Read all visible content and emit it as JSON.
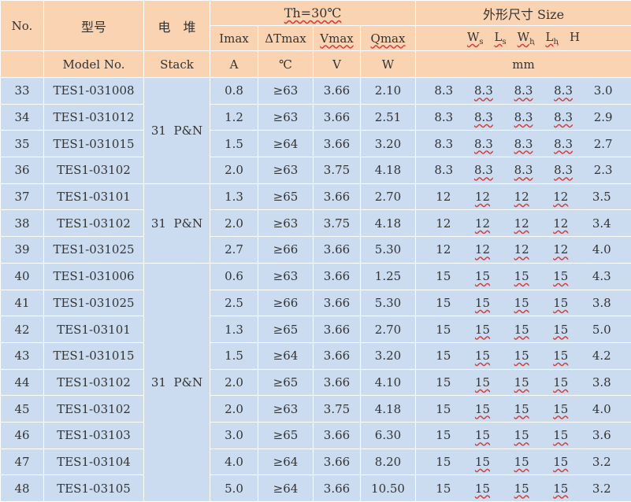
{
  "headers": {
    "no": "No.",
    "model_cn": "型号",
    "stack_cn": "电　堆",
    "th": "Th=30℃",
    "size": "外形尺寸 Size",
    "imax": "Imax",
    "dtmax": "ΔTmax",
    "vmax": "Vmax",
    "qmax": "Qmax",
    "w": "W",
    "w_sub": "s",
    "l": "L",
    "l_sub": "s",
    "wh": "W",
    "wh_sub": "h",
    "lh": "L",
    "lh_sub": "h",
    "h": "H",
    "model_en": "Model No.",
    "stack_en": "Stack",
    "unit_a": "A",
    "unit_c": "℃",
    "unit_v": "V",
    "unit_w": "W",
    "unit_mm": "mm"
  },
  "stack_groups": [
    "31  P&N",
    "31  P&N",
    "31  P&N"
  ],
  "rows": [
    {
      "no": "33",
      "model": "TES1-031008",
      "imax": "0.8",
      "dt": "≥63",
      "v": "3.66",
      "q": "2.10",
      "s": [
        "8.3",
        "8.3",
        "8.3",
        "8.3",
        "3.0"
      ]
    },
    {
      "no": "34",
      "model": "TES1-031012",
      "imax": "1.2",
      "dt": "≥63",
      "v": "3.66",
      "q": "2.51",
      "s": [
        "8.3",
        "8.3",
        "8.3",
        "8.3",
        "2.9"
      ]
    },
    {
      "no": "35",
      "model": "TES1-031015",
      "imax": "1.5",
      "dt": "≥64",
      "v": "3.66",
      "q": "3.20",
      "s": [
        "8.3",
        "8.3",
        "8.3",
        "8.3",
        "2.7"
      ]
    },
    {
      "no": "36",
      "model": "TES1-03102",
      "imax": "2.0",
      "dt": "≥63",
      "v": "3.75",
      "q": "4.18",
      "s": [
        "8.3",
        "8.3",
        "8.3",
        "8.3",
        "2.3"
      ]
    },
    {
      "no": "37",
      "model": "TES1-03101",
      "imax": "1.3",
      "dt": "≥65",
      "v": "3.66",
      "q": "2.70",
      "s": [
        "12",
        "12",
        "12",
        "12",
        "3.5"
      ]
    },
    {
      "no": "38",
      "model": "TES1-03102",
      "imax": "2.0",
      "dt": "≥63",
      "v": "3.75",
      "q": "4.18",
      "s": [
        "12",
        "12",
        "12",
        "12",
        "3.4"
      ]
    },
    {
      "no": "39",
      "model": "TES1-031025",
      "imax": "2.7",
      "dt": "≥66",
      "v": "3.66",
      "q": "5.30",
      "s": [
        "12",
        "12",
        "12",
        "12",
        "4.0"
      ]
    },
    {
      "no": "40",
      "model": "TES1-031006",
      "imax": "0.6",
      "dt": "≥63",
      "v": "3.66",
      "q": "1.25",
      "s": [
        "15",
        "15",
        "15",
        "15",
        "4.3"
      ]
    },
    {
      "no": "41",
      "model": "TES1-031025",
      "imax": "2.5",
      "dt": "≥66",
      "v": "3.66",
      "q": "5.30",
      "s": [
        "15",
        "15",
        "15",
        "15",
        "3.8"
      ]
    },
    {
      "no": "42",
      "model": "TES1-03101",
      "imax": "1.3",
      "dt": "≥65",
      "v": "3.66",
      "q": "2.70",
      "s": [
        "15",
        "15",
        "15",
        "15",
        "5.0"
      ]
    },
    {
      "no": "43",
      "model": "TES1-031015",
      "imax": "1.5",
      "dt": "≥64",
      "v": "3.66",
      "q": "3.20",
      "s": [
        "15",
        "15",
        "15",
        "15",
        "4.2"
      ]
    },
    {
      "no": "44",
      "model": "TES1-03102",
      "imax": "2.0",
      "dt": "≥65",
      "v": "3.66",
      "q": "4.10",
      "s": [
        "15",
        "15",
        "15",
        "15",
        "3.8"
      ]
    },
    {
      "no": "45",
      "model": "TES1-03102",
      "imax": "2.0",
      "dt": "≥63",
      "v": "3.75",
      "q": "4.18",
      "s": [
        "15",
        "15",
        "15",
        "15",
        "4.0"
      ]
    },
    {
      "no": "46",
      "model": "TES1-03103",
      "imax": "3.0",
      "dt": "≥65",
      "v": "3.66",
      "q": "6.30",
      "s": [
        "15",
        "15",
        "15",
        "15",
        "3.6"
      ]
    },
    {
      "no": "47",
      "model": "TES1-03104",
      "imax": "4.0",
      "dt": "≥64",
      "v": "3.66",
      "q": "8.20",
      "s": [
        "15",
        "15",
        "15",
        "15",
        "3.2"
      ]
    },
    {
      "no": "48",
      "model": "TES1-03105",
      "imax": "5.0",
      "dt": "≥64",
      "v": "3.66",
      "q": "10.50",
      "s": [
        "15",
        "15",
        "15",
        "15",
        "3.2"
      ]
    }
  ],
  "colors": {
    "header_bg": "#fad3b2",
    "body_bg": "#cbdcf0",
    "grid": "#ffffff"
  }
}
